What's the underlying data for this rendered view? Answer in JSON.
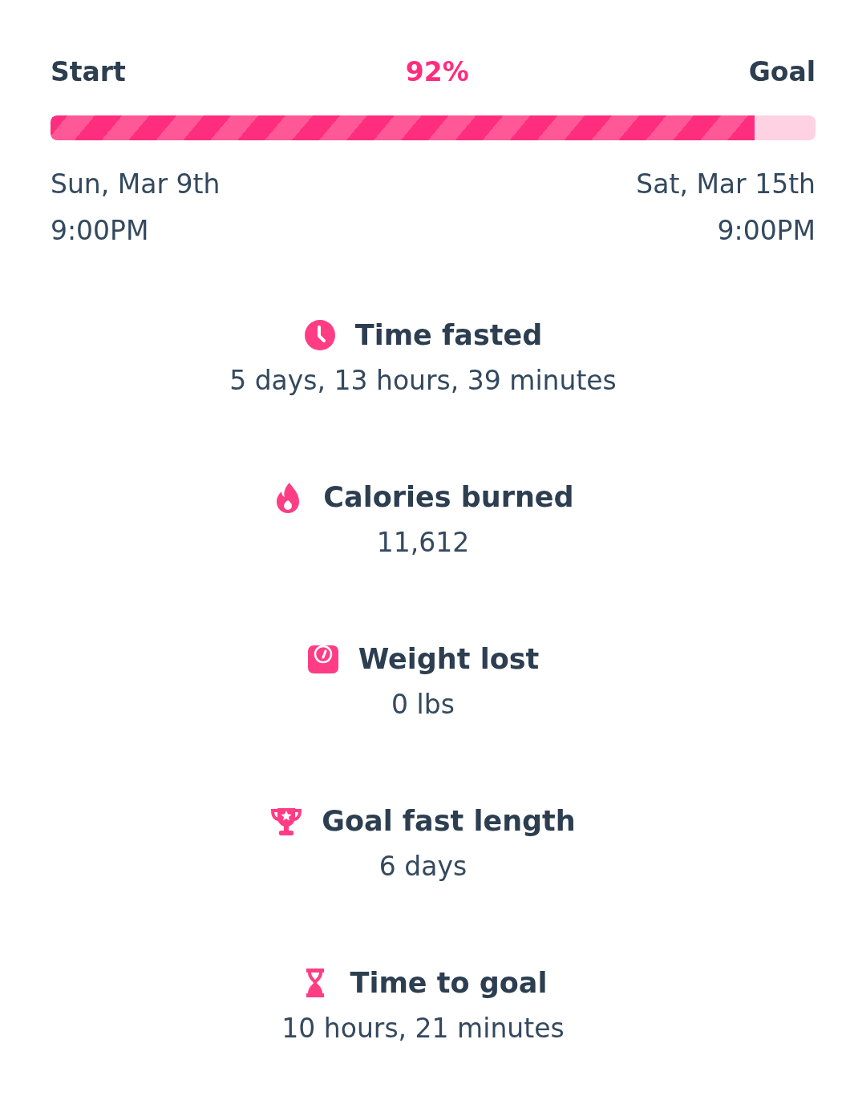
{
  "progress": {
    "start_label": "Start",
    "percent": "92%",
    "goal_label": "Goal",
    "level": 0.92,
    "start_date": "Sun, Mar 9th",
    "start_time": "9:00PM",
    "goal_date": "Sat, Mar 15th",
    "goal_time": "9:00PM"
  },
  "stats": [
    {
      "kind": "clock",
      "title": "Time fasted",
      "value": "5 days, 13 hours, 39 minutes"
    },
    {
      "kind": "flame",
      "title": "Calories burned",
      "value": "11,612"
    },
    {
      "kind": "scale",
      "title": "Weight lost",
      "value": "0 lbs"
    },
    {
      "kind": "trophy",
      "title": "Goal fast length",
      "value": "6 days"
    },
    {
      "kind": "hourglass",
      "title": "Time to goal",
      "value": "10 hours, 21 minutes"
    }
  ]
}
